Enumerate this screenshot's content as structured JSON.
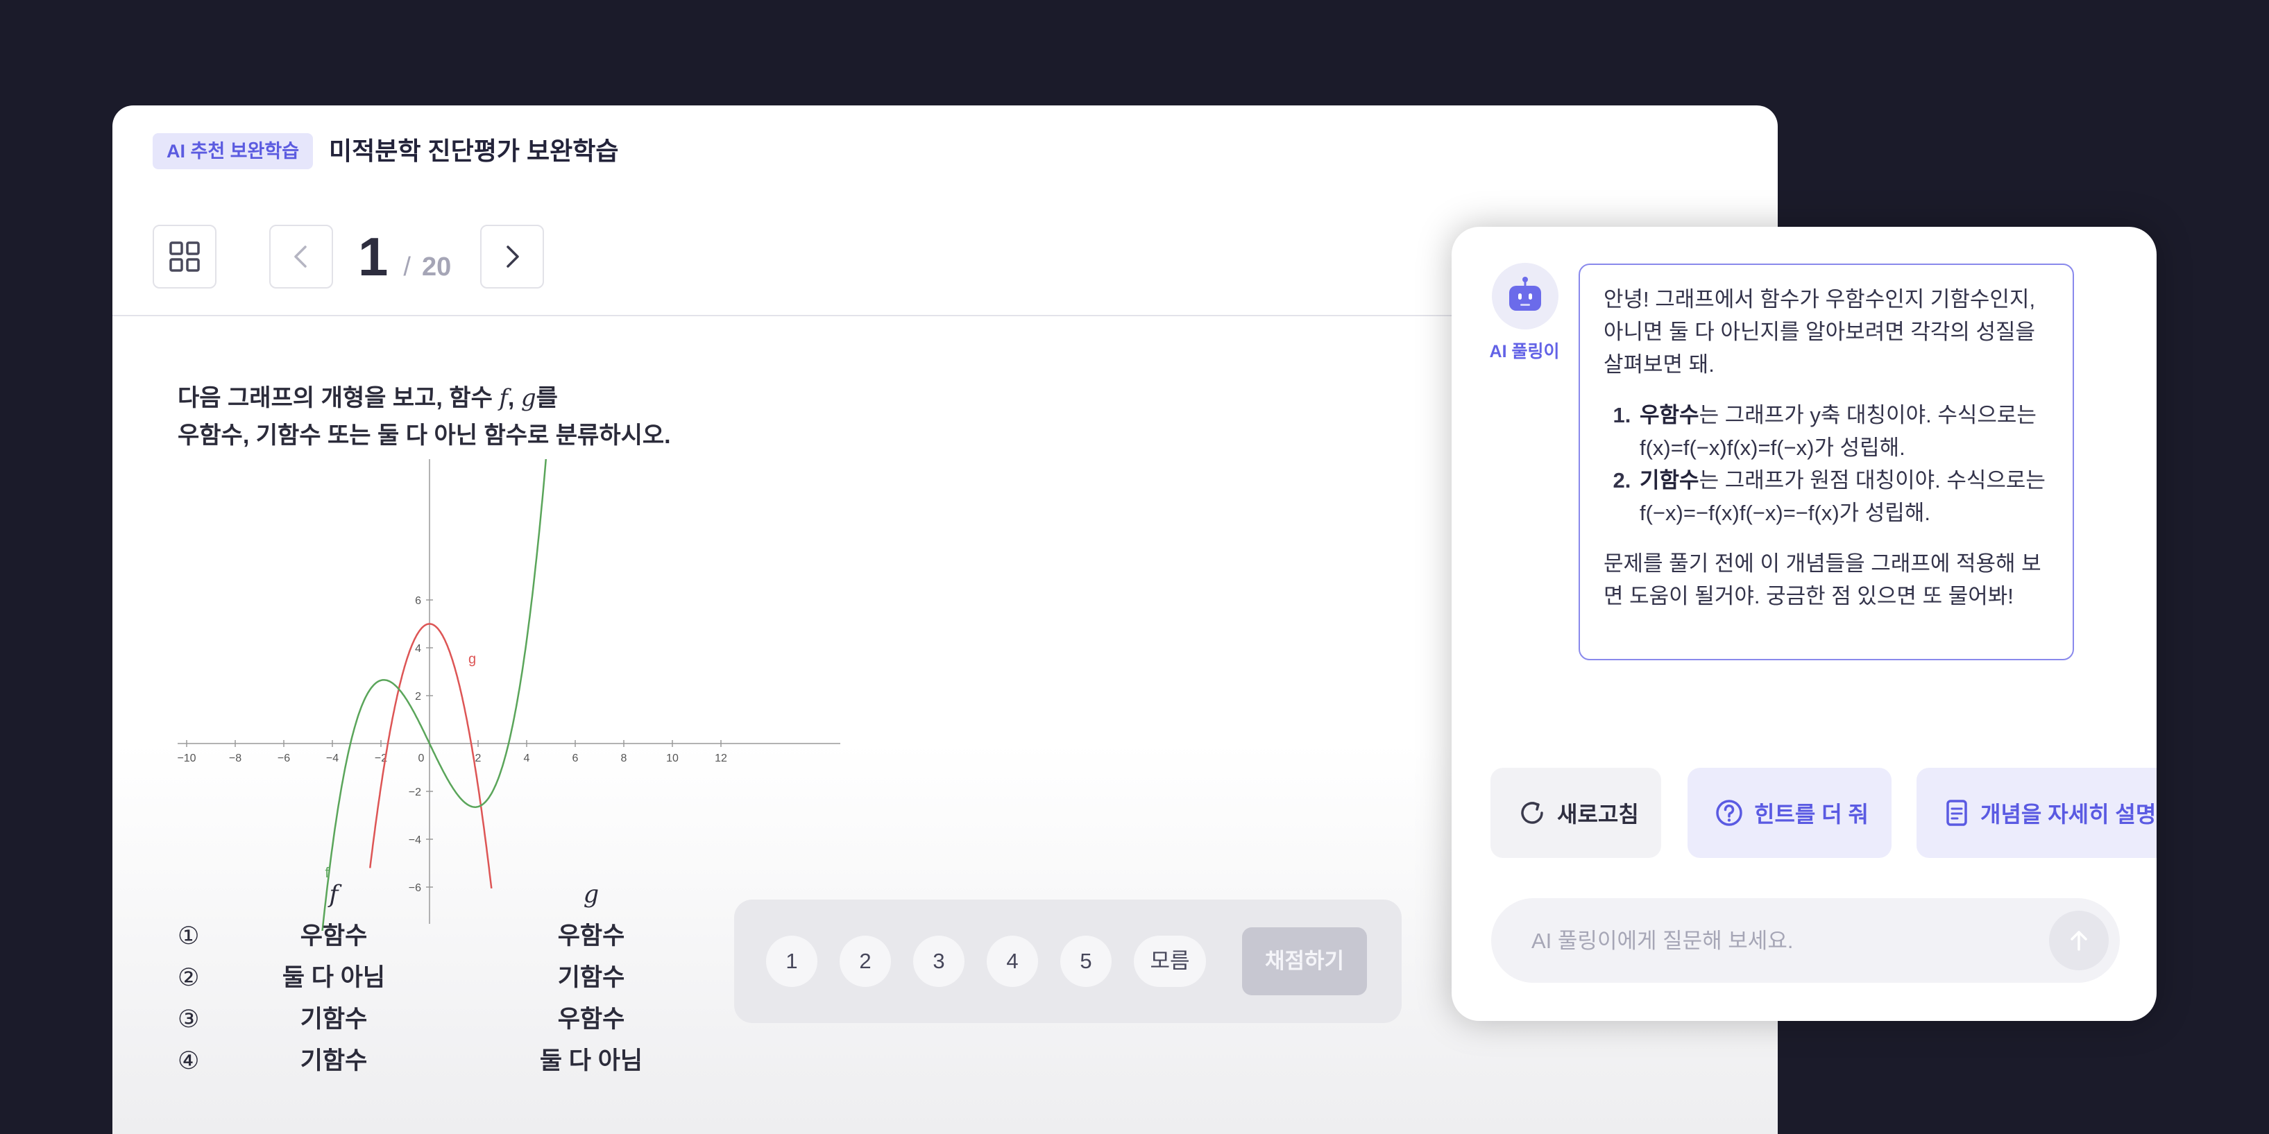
{
  "header": {
    "badge": "AI 추천 보완학습",
    "title": "미적분학 진단평가 보완학습"
  },
  "pager": {
    "current": "1",
    "separator": "/",
    "total": "20"
  },
  "question": {
    "line1_before": "다음 그래프의 개형을 보고, 함수 ",
    "f": "f",
    "comma": ", ",
    "g": "g",
    "line1_after": "를",
    "line2": "우함수, 기함수 또는 둘 다 아닌 함수로 분류하시오."
  },
  "graph": {
    "x_ticks": [
      "−10",
      "−8",
      "−6",
      "−4",
      "−2",
      "0",
      "2",
      "4",
      "6",
      "8",
      "10",
      "12"
    ],
    "y_ticks": [
      "6",
      "4",
      "2",
      "−2",
      "−4",
      "−6"
    ],
    "label_f": "f",
    "label_g": "g",
    "colors": {
      "f": "#5aa55a",
      "g": "#dd5555",
      "axis": "#9a9a9a"
    }
  },
  "choices": {
    "headers": [
      "f",
      "g"
    ],
    "rows": [
      {
        "num": "①",
        "f": "우함수",
        "g": "우함수"
      },
      {
        "num": "②",
        "f": "둘 다 아님",
        "g": "기함수"
      },
      {
        "num": "③",
        "f": "기함수",
        "g": "우함수"
      },
      {
        "num": "④",
        "f": "기함수",
        "g": "둘 다 아님"
      }
    ]
  },
  "answer_bar": {
    "options": [
      "1",
      "2",
      "3",
      "4",
      "5"
    ],
    "unknown": "모름",
    "submit": "채점하기"
  },
  "ai_panel": {
    "name": "AI 풀링이",
    "message": {
      "intro": "안녕! 그래프에서 함수가 우함수인지 기함수인지, 아니면 둘 다 아닌지를 알아보려면 각각의 성질을 살펴보면 돼.",
      "item1_bold": "우함수",
      "item1_rest": "는 그래프가 y축 대칭이야. 수식으로는 f(x)=f(−x)f(x)=f(−x)가 성립해.",
      "item2_bold": "기함수",
      "item2_rest": "는 그래프가 원점 대칭이야. 수식으로는 f(−x)=−f(x)f(−x)=−f(x)가 성립해.",
      "outro": "문제를 풀기 전에 이 개념들을 그래프에 적용해 보면 도움이 될거야. 궁금한 점 있으면 또 물어봐!"
    },
    "chips": {
      "refresh": "새로고침",
      "hint": "힌트를 더 줘",
      "explain": "개념을 자세히 설명해"
    },
    "input_placeholder": "AI 풀링이에게 질문해 보세요.",
    "accent": "#5a5ae2"
  }
}
